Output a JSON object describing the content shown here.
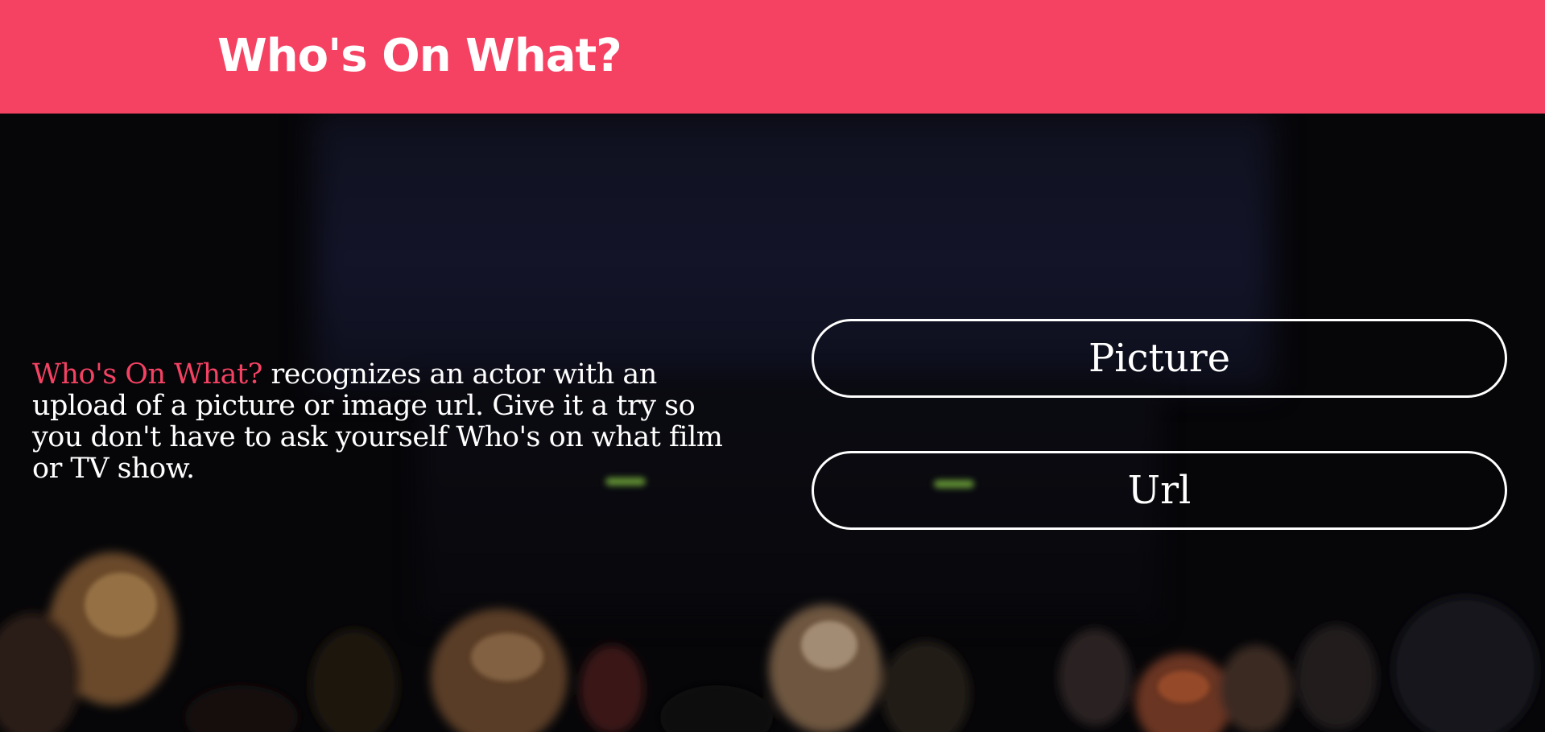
{
  "header": {
    "title": "Who's On What?"
  },
  "intro": {
    "brand": "Who's On What?",
    "text": " recognizes an actor with an upload of a picture or image url. Give it a try so you don't have to ask yourself Who's on what film or TV show."
  },
  "actions": {
    "picture_label": "Picture",
    "url_label": "Url"
  },
  "colors": {
    "accent": "#f54263",
    "text": "#ffffff",
    "background": "#050508"
  }
}
